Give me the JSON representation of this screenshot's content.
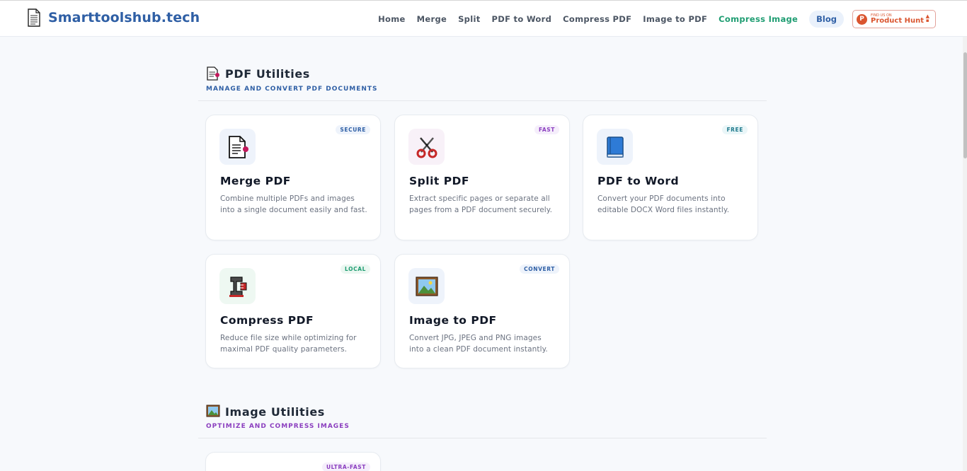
{
  "header": {
    "brand": "Smarttoolshub.tech",
    "nav": [
      "Home",
      "Merge",
      "Split",
      "PDF to Word",
      "Compress PDF",
      "Image to PDF",
      "Compress Image"
    ],
    "active_nav": "Compress Image",
    "blog_label": "Blog",
    "product_hunt": {
      "small": "FIND US ON",
      "big": "Product Hunt",
      "logo_letter": "P"
    }
  },
  "colors": {
    "brand_blue": "#2f5fa5",
    "active_green": "#1f9d72",
    "image_purple": "#8b3fbf"
  },
  "sections": [
    {
      "title": "PDF Utilities",
      "subtitle": "MANAGE AND CONVERT PDF DOCUMENTS",
      "icon": "document-icon",
      "cards": [
        {
          "title": "Merge PDF",
          "badge": "SECURE",
          "icon": "document-merge-icon",
          "desc": "Combine multiple PDFs and images into a single document easily and fast."
        },
        {
          "title": "Split PDF",
          "badge": "FAST",
          "icon": "scissors-icon",
          "desc": "Extract specific pages or separate all pages from a PDF document securely."
        },
        {
          "title": "PDF to Word",
          "badge": "FREE",
          "icon": "blue-book-icon",
          "desc": "Convert your PDF documents into editable DOCX Word files instantly."
        },
        {
          "title": "Compress PDF",
          "badge": "LOCAL",
          "icon": "clamp-icon",
          "desc": "Reduce file size while optimizing for maximal PDF quality parameters."
        },
        {
          "title": "Image to PDF",
          "badge": "CONVERT",
          "icon": "framed-picture-icon",
          "desc": "Convert JPG, JPEG and PNG images into a clean PDF document instantly."
        }
      ]
    },
    {
      "title": "Image Utilities",
      "subtitle": "OPTIMIZE AND COMPRESS IMAGES",
      "icon": "framed-picture-icon",
      "cards": [
        {
          "badge": "ULTRA-FAST"
        }
      ]
    }
  ]
}
